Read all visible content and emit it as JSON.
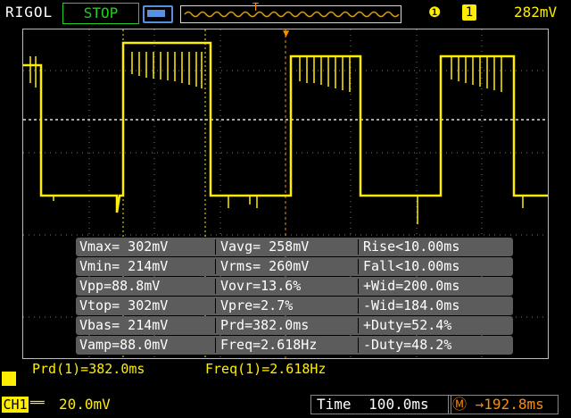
{
  "header": {
    "brand": "RIGOL",
    "run_state": "STOP",
    "trigger": {
      "edge_icon": "rising-edge-icon",
      "channel": "1",
      "level": "282mV"
    }
  },
  "measurements": [
    [
      "Vmax= 302mV",
      "Vavg= 258mV",
      "Rise<10.00ms"
    ],
    [
      "Vmin= 214mV",
      "Vrms= 260mV",
      "Fall<10.00ms"
    ],
    [
      "Vpp=88.8mV",
      "Vovr=13.6%",
      "+Wid=200.0ms"
    ],
    [
      "Vtop= 302mV",
      "Vpre=2.7%",
      "-Wid=184.0ms"
    ],
    [
      "Vbas= 214mV",
      "Prd=382.0ms",
      "+Duty=52.4%"
    ],
    [
      "Vamp=88.0mV",
      "Freq=2.618Hz",
      "-Duty=48.2%"
    ]
  ],
  "cursor": {
    "period": "Prd(1)=382.0ms",
    "frequency": "Freq(1)=2.618Hz"
  },
  "footer": {
    "channel": "CH1",
    "coupling": "══",
    "volts_div": "20.0mV",
    "time_label": "Time",
    "time_div": "100.0ms",
    "trigger_delay": "→192.8ms"
  },
  "colors": {
    "trace": "#ffee00",
    "trigger": "#ff8c00",
    "run_state": "#1fd01f"
  }
}
